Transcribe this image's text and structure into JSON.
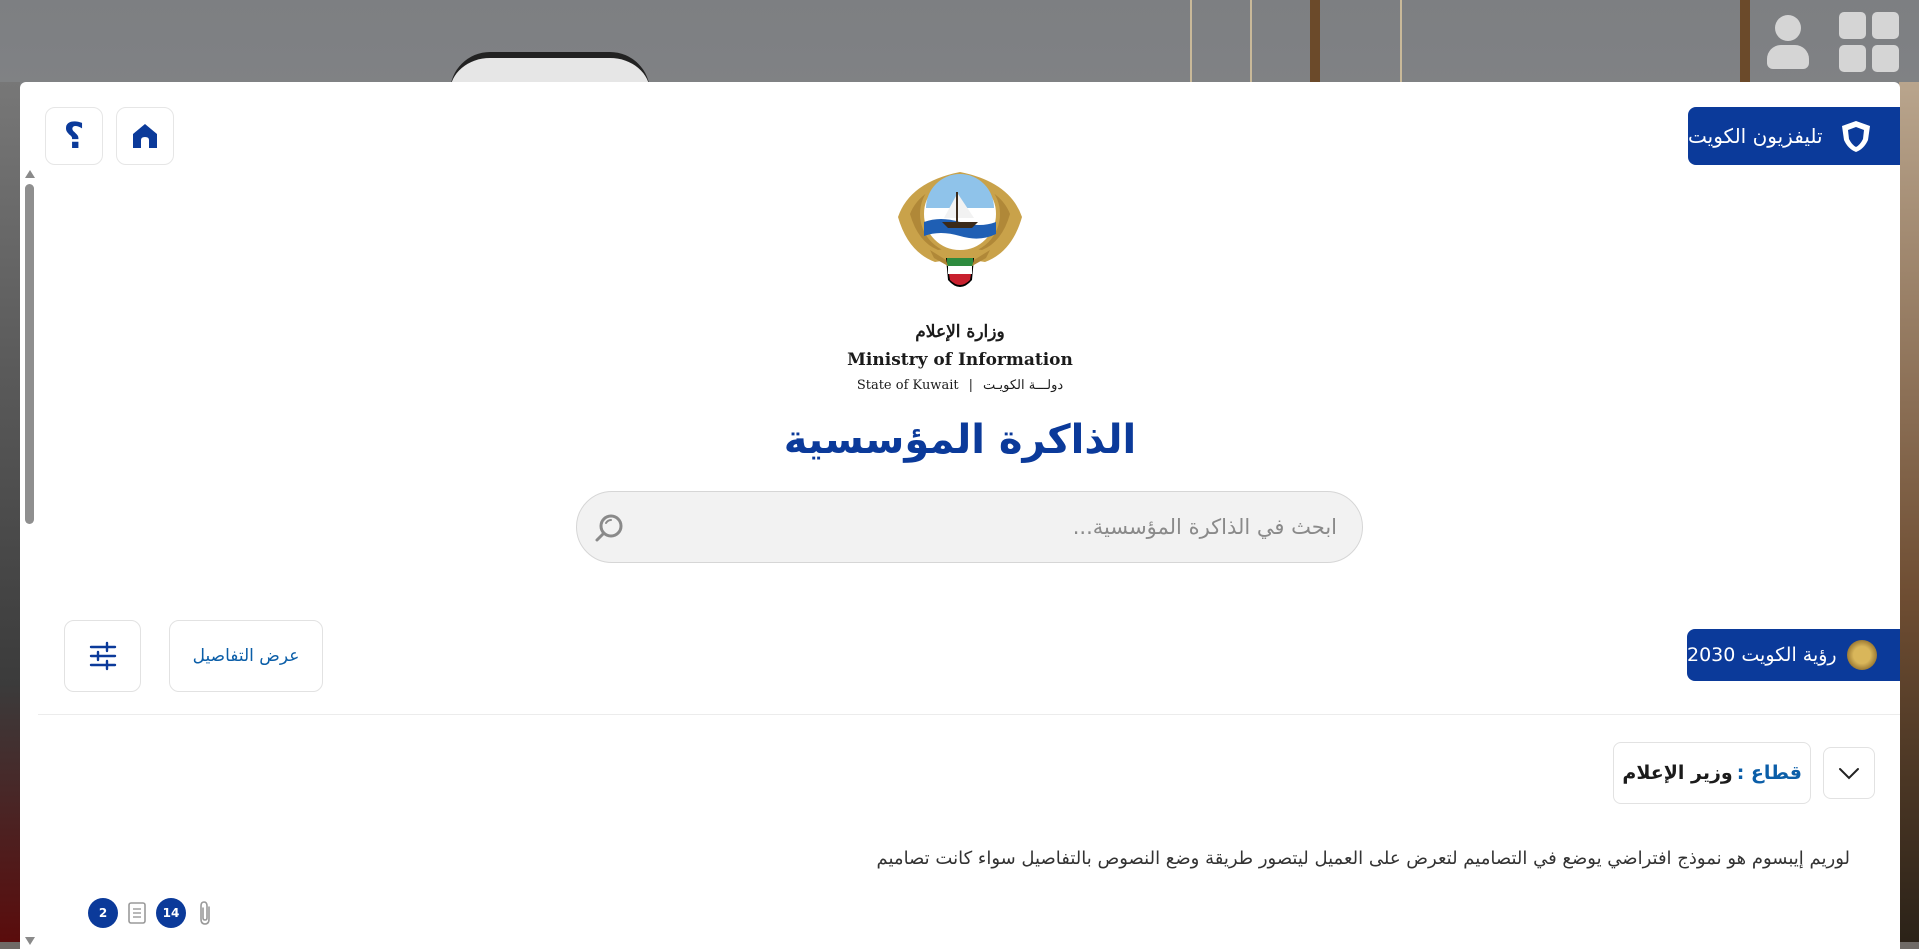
{
  "header": {
    "tv_tab_label": "تليفزيون الكويت"
  },
  "logo": {
    "ministry_ar": "وزارة الإعلام",
    "ministry_en": "Ministry of Information",
    "state_en": "State of Kuwait",
    "state_ar": "دولـــة الكويـت",
    "separator": "|"
  },
  "page": {
    "title": "الذاكرة المؤسسية"
  },
  "search": {
    "placeholder": "ابحث في الذاكرة المؤسسية..."
  },
  "toolbar": {
    "vision_label": "رؤية الكويت 2030",
    "details_label": "عرض التفاصيل"
  },
  "sector": {
    "label": "قطاع :",
    "value": "وزير الإعلام"
  },
  "item": {
    "description": "لوريم إيبسوم هو نموذج افتراضي يوضع في التصاميم لتعرض على العميل ليتصور طريقة وضع النصوص بالتفاصيل سواء كانت تصاميم",
    "documents_count": "2",
    "attachments_count": "14"
  },
  "colors": {
    "brand_blue": "#0b3a9a",
    "link_blue": "#0b5ea8"
  }
}
